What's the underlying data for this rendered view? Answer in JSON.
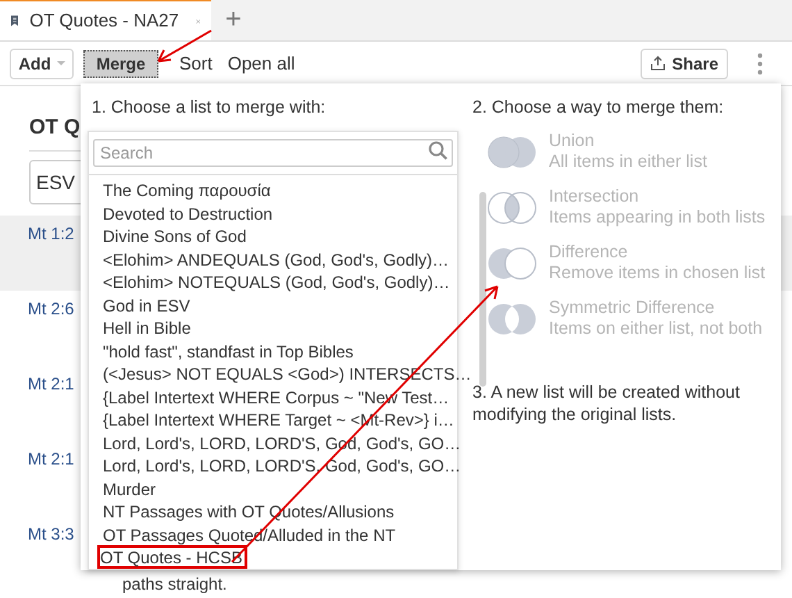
{
  "tab": {
    "title": "OT Quotes - NA27",
    "selected": true
  },
  "new_tab": "+",
  "toolbar": {
    "add": "Add",
    "merge": "Merge",
    "sort": "Sort",
    "open_all": "Open all",
    "share": "Share"
  },
  "page": {
    "heading": "OT Q",
    "version": "ESV",
    "rows": [
      {
        "ref": "Mt 1:2",
        "selected": true
      },
      {
        "ref": "Mt 2:6",
        "selected": false
      },
      {
        "ref": "Mt 2:1",
        "selected": false
      },
      {
        "ref": "Mt 2:1",
        "selected": false
      },
      {
        "ref": "Mt 3:3",
        "selected": false,
        "text": "paths straight."
      }
    ]
  },
  "merge_popup": {
    "step1": "1. Choose a list to merge with:",
    "search": {
      "placeholder": "Search"
    },
    "lists": [
      {
        "label": "The Coming παρουσία",
        "highlighted": false
      },
      {
        "label": "Devoted to Destruction",
        "highlighted": false
      },
      {
        "label": "Divine Sons of God",
        "highlighted": false
      },
      {
        "label": "<Elohim> ANDEQUALS (God, God's, Godly)…",
        "highlighted": false
      },
      {
        "label": "<Elohim> NOTEQUALS (God, God's, Godly)…",
        "highlighted": false
      },
      {
        "label": "God in ESV",
        "highlighted": false
      },
      {
        "label": "Hell in Bible",
        "highlighted": false
      },
      {
        "label": "\"hold fast\", standfast in Top Bibles",
        "highlighted": false
      },
      {
        "label": "(<Jesus> NOT EQUALS <God>) INTERSECTS…",
        "highlighted": false
      },
      {
        "label": "{Label Intertext WHERE Corpus ~ \"New Test…",
        "highlighted": false
      },
      {
        "label": "{Label Intertext WHERE Target ~ <Mt-Rev>} i…",
        "highlighted": false
      },
      {
        "label": "Lord, Lord's, LORD, LORD'S, God, God's, GO…",
        "highlighted": false
      },
      {
        "label": "Lord, Lord's, LORD, LORD'S, God, God's, GO…",
        "highlighted": false
      },
      {
        "label": "Murder",
        "highlighted": false
      },
      {
        "label": "NT Passages with OT Quotes/Allusions",
        "highlighted": false
      },
      {
        "label": "OT Passages Quoted/Alluded in the NT",
        "highlighted": false
      },
      {
        "label": "OT Quotes - HCSB",
        "highlighted": true
      }
    ],
    "step2": "2. Choose a way to merge them:",
    "methods": [
      {
        "kind": "union",
        "title": "Union",
        "description": "All items in either list",
        "disabled": true
      },
      {
        "kind": "intersection",
        "title": "Intersection",
        "description": "Items appearing in both lists",
        "disabled": true
      },
      {
        "kind": "difference",
        "title": "Difference",
        "description": "Remove items in chosen list",
        "disabled": true
      },
      {
        "kind": "symmetric",
        "title": "Symmetric Difference",
        "description": "Items on either list, not both",
        "disabled": true
      }
    ],
    "step3": "3. A new list will be created without modifying the original lists."
  }
}
